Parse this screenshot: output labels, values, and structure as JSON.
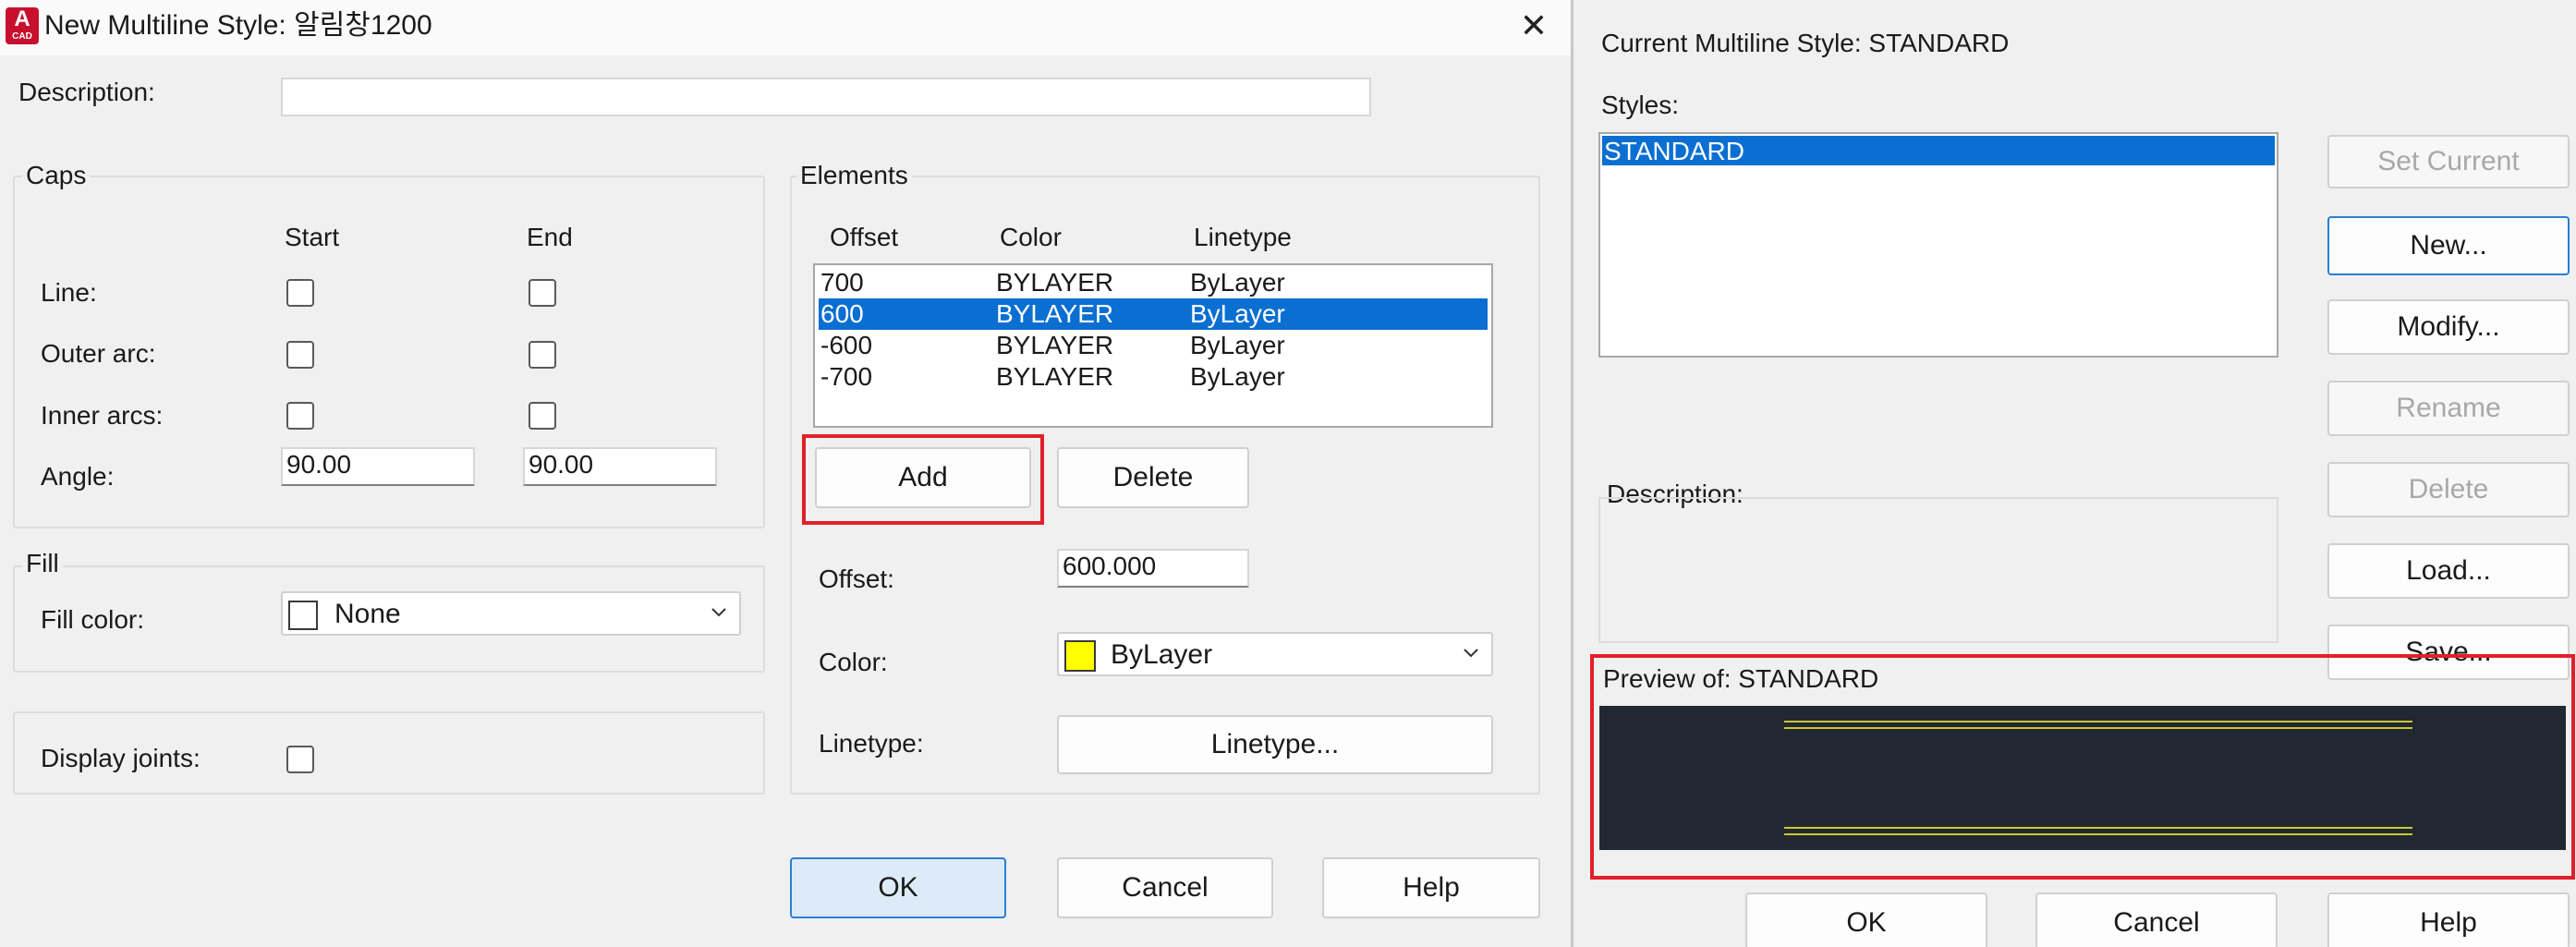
{
  "left": {
    "title": "New Multiline Style: 알림창1200",
    "app_logo": {
      "letter": "A",
      "caption": "CAD"
    },
    "close_glyph": "✕",
    "description_label": "Description:",
    "description_value": "",
    "caps": {
      "group_label": "Caps",
      "col_start": "Start",
      "col_end": "End",
      "line_label": "Line:",
      "outer_arc_label": "Outer arc:",
      "inner_arcs_label": "Inner arcs:",
      "angle_label": "Angle:",
      "angle_start": "90.00",
      "angle_end": "90.00"
    },
    "fill": {
      "group_label": "Fill",
      "fill_color_label": "Fill color:",
      "fill_color_value": "None"
    },
    "display_joints_label": "Display joints:",
    "elements": {
      "group_label": "Elements",
      "headers": [
        "Offset",
        "Color",
        "Linetype"
      ],
      "rows": [
        [
          "700",
          "BYLAYER",
          "ByLayer"
        ],
        [
          "600",
          "BYLAYER",
          "ByLayer"
        ],
        [
          "-600",
          "BYLAYER",
          "ByLayer"
        ],
        [
          "-700",
          "BYLAYER",
          "ByLayer"
        ]
      ],
      "selected_row": 1,
      "add_label": "Add",
      "delete_label": "Delete",
      "offset_label": "Offset:",
      "offset_value": "600.000",
      "color_label": "Color:",
      "color_value": "ByLayer",
      "color_swatch": "#ffff00",
      "linetype_label": "Linetype:",
      "linetype_button": "Linetype..."
    },
    "ok_label": "OK",
    "cancel_label": "Cancel",
    "help_label": "Help"
  },
  "right": {
    "current_style": "Current Multiline Style: STANDARD",
    "styles_label": "Styles:",
    "styles": [
      "STANDARD"
    ],
    "set_current_label": "Set Current",
    "new_label": "New...",
    "modify_label": "Modify...",
    "rename_label": "Rename",
    "delete_label": "Delete",
    "load_label": "Load...",
    "save_label": "Save...",
    "description_label": "Description:",
    "preview_label": "Preview of: STANDARD",
    "ok_label": "OK",
    "cancel_label": "Cancel",
    "help_label": "Help"
  },
  "colors": {
    "highlight_red": "#e0202a",
    "selection_blue": "#0a6fd0",
    "preview_bg": "#222831",
    "preview_line": "#c9c931"
  }
}
